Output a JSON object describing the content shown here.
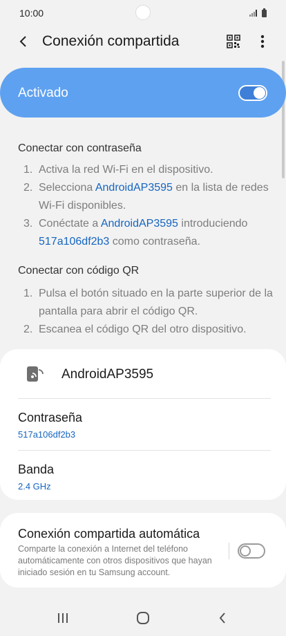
{
  "status_bar": {
    "time": "10:00"
  },
  "header": {
    "title": "Conexión compartida",
    "back_icon": "back-arrow-icon",
    "qr_icon": "qr-code-icon",
    "more_icon": "more-vert-icon"
  },
  "master_switch": {
    "label": "Activado",
    "state": true
  },
  "password_section": {
    "heading": "Conectar con contraseña",
    "steps": [
      {
        "num": "1.",
        "text_a": "Activa la red Wi-Fi en el dispositivo."
      },
      {
        "num": "2.",
        "text_a": "Selecciona ",
        "link": "AndroidAP3595",
        "text_b": " en la lista de redes Wi-Fi disponibles."
      },
      {
        "num": "3.",
        "text_a": "Conéctate a ",
        "link": "AndroidAP3595",
        "text_b": " introduciendo ",
        "link2": "517a106df2b3",
        "text_c": " como contraseña."
      }
    ]
  },
  "qr_section": {
    "heading": "Conectar con código QR",
    "steps": [
      {
        "num": "1.",
        "text": "Pulsa el botón situado en la parte superior de la pantalla para abrir el código QR."
      },
      {
        "num": "2.",
        "text": "Escanea el código QR del otro dispositivo."
      }
    ]
  },
  "device_card": {
    "name": "AndroidAP3595",
    "password_label": "Contraseña",
    "password_value": "517a106df2b3",
    "band_label": "Banda",
    "band_value": "2.4 GHz"
  },
  "auto_card": {
    "title": "Conexión compartida automática",
    "description": "Comparte la conexión a Internet del teléfono automáticamente con otros dispositivos que hayan iniciado sesión en tu Samsung account.",
    "state": false
  },
  "colors": {
    "accent": "#5ea1f0",
    "link": "#1565c0"
  }
}
